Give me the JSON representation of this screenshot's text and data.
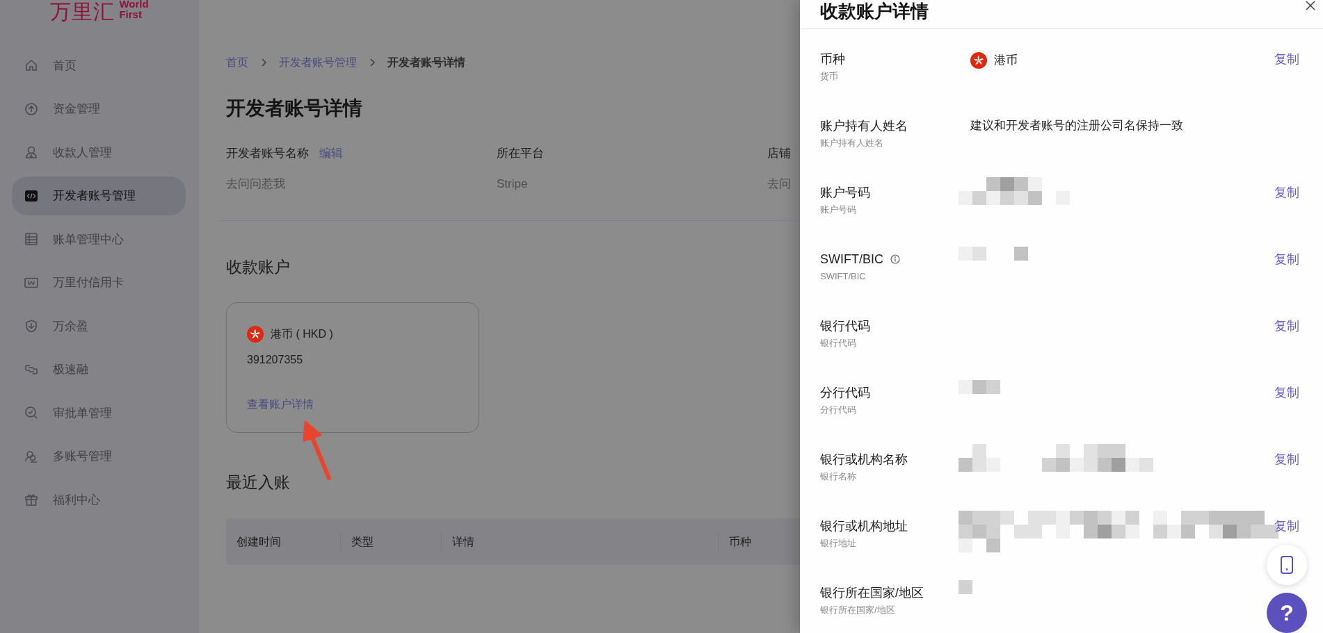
{
  "logo": {
    "mark": "万里汇",
    "line_1": "World",
    "line_2": "First"
  },
  "sidebar": {
    "items": [
      {
        "label": "首页",
        "selected": false
      },
      {
        "label": "资金管理",
        "selected": false
      },
      {
        "label": "收款人管理",
        "selected": false
      },
      {
        "label": "开发者账号管理",
        "selected": true
      },
      {
        "label": "账单管理中心",
        "selected": false
      },
      {
        "label": "万里付信用卡",
        "selected": false
      },
      {
        "label": "万余盈",
        "selected": false
      },
      {
        "label": "极速融",
        "selected": false
      },
      {
        "label": "审批单管理",
        "selected": false
      },
      {
        "label": "多账号管理",
        "selected": false
      },
      {
        "label": "福利中心",
        "selected": false
      }
    ]
  },
  "breadcrumb": [
    {
      "label": "首页",
      "current": false
    },
    {
      "label": "开发者账号管理",
      "current": false
    },
    {
      "label": "开发者账号详情",
      "current": true
    }
  ],
  "page_title": "开发者账号详情",
  "info_fields": [
    {
      "label": "开发者账号名称",
      "action": "编辑",
      "value": "去问问惹我"
    },
    {
      "label": "所在平台",
      "value": "Stripe"
    },
    {
      "label": "店铺",
      "value": "去问"
    }
  ],
  "accounts": {
    "title": "收款账户",
    "card": {
      "currency": "港币 ( HKD )",
      "number": "391207355",
      "link": "查看账户详情"
    }
  },
  "recent": {
    "title": "最近入账",
    "columns": [
      "创建时间",
      "类型",
      "详情",
      "币种"
    ]
  },
  "drawer": {
    "title": "收款账户详情",
    "rows": [
      {
        "label": "币种",
        "sublabel": "货币",
        "kind": "currency",
        "value": "港币",
        "copy": "复制"
      },
      {
        "label": "账户持有人姓名",
        "sublabel": "账户持有人姓名",
        "kind": "text",
        "value": "建议和开发者账号的注册公司名保持一致"
      },
      {
        "label": "账户号码",
        "sublabel": "账户号码",
        "kind": "redacted",
        "copy": "复制"
      },
      {
        "label": "SWIFT/BIC",
        "sublabel": "SWIFT/BIC",
        "kind": "redacted",
        "info": true,
        "copy": "复制"
      },
      {
        "label": "银行代码",
        "sublabel": "银行代码",
        "kind": "empty",
        "copy": "复制"
      },
      {
        "label": "分行代码",
        "sublabel": "分行代码",
        "kind": "redacted",
        "copy": "复制"
      },
      {
        "label": "银行或机构名称",
        "sublabel": "银行名称",
        "kind": "redacted",
        "copy": "复制"
      },
      {
        "label": "银行或机构地址",
        "sublabel": "银行地址",
        "kind": "redacted",
        "copy": "复制"
      },
      {
        "label": "银行所在国家/地区",
        "sublabel": "银行所在国家/地区",
        "kind": "redacted"
      }
    ]
  },
  "help_button": "?"
}
